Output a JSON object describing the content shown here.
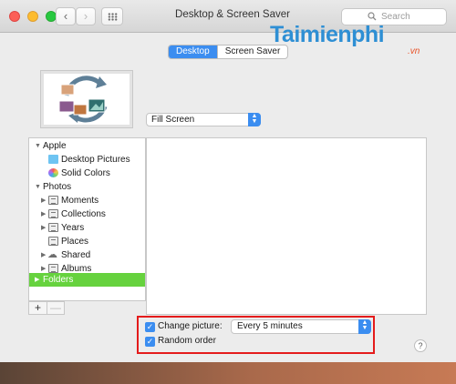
{
  "window": {
    "title": "Desktop & Screen Saver"
  },
  "toolbar": {
    "back_glyph": "‹",
    "forward_glyph": "›",
    "search_placeholder": "Search"
  },
  "watermark": {
    "main": "Taimienphi",
    "sub": ".vn"
  },
  "tabs": [
    {
      "label": "Desktop",
      "selected": true
    },
    {
      "label": "Screen Saver",
      "selected": false
    }
  ],
  "fit_popup": {
    "value": "Fill Screen"
  },
  "sidebar": {
    "groups": [
      {
        "label": "Apple",
        "expanded": true,
        "items": [
          {
            "label": "Desktop Pictures",
            "icon": "folder-icon"
          },
          {
            "label": "Solid Colors",
            "icon": "color-wheel-icon"
          }
        ]
      },
      {
        "label": "Photos",
        "expanded": true,
        "items": [
          {
            "label": "Moments",
            "icon": "album-icon",
            "expandable": true
          },
          {
            "label": "Collections",
            "icon": "album-icon",
            "expandable": true
          },
          {
            "label": "Years",
            "icon": "album-icon",
            "expandable": true
          },
          {
            "label": "Places",
            "icon": "album-icon",
            "expandable": false
          },
          {
            "label": "Shared",
            "icon": "cloud-icon",
            "expandable": true
          },
          {
            "label": "Albums",
            "icon": "album-icon",
            "expandable": true
          }
        ]
      },
      {
        "label": "Folders",
        "expanded": false,
        "selected": true,
        "items": []
      }
    ],
    "add_label": "+",
    "remove_label": "—"
  },
  "options": {
    "change_picture_label": "Change picture:",
    "change_picture_checked": true,
    "interval_value": "Every 5 minutes",
    "random_order_label": "Random order",
    "random_order_checked": true
  },
  "help_label": "?",
  "colors": {
    "accent": "#3b8df0",
    "selection": "#66d23e",
    "highlight_box": "#e41b1b"
  }
}
